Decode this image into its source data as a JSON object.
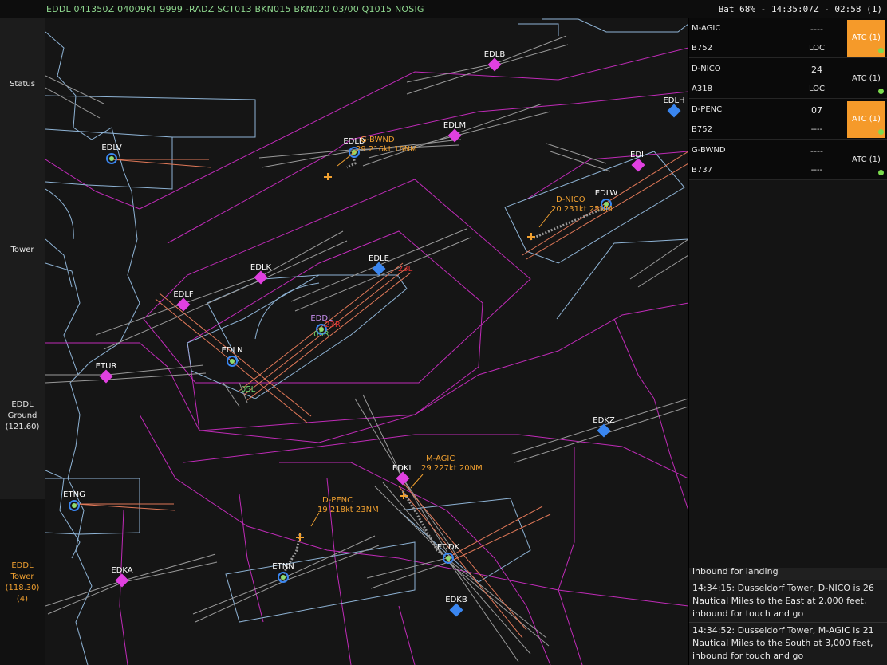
{
  "metar": "EDDL 041350Z 04009KT 9999 -RADZ SCT013 BKN015 BKN020 03/00 Q1015 NOSIG",
  "status_bar": "Bat 68% - 14:35:07Z - 02:58 (1)",
  "sidebar": {
    "status": "Status",
    "tower": "Tower",
    "ground_name": "EDDL",
    "ground_role": "Ground",
    "ground_freq": "(121.60)",
    "active_name": "EDDL",
    "active_role": "Tower",
    "active_freq": "(118.30)",
    "active_count": "(4)"
  },
  "strips": [
    {
      "callsign": "M-AGIC",
      "type": "B752",
      "runway": "----",
      "approach": "LOC",
      "atc": "ATC (1)",
      "highlight": true
    },
    {
      "callsign": "D-NICO",
      "type": "A318",
      "runway": "24",
      "approach": "LOC",
      "atc": "ATC (1)",
      "highlight": false
    },
    {
      "callsign": "D-PENC",
      "type": "B752",
      "runway": "07",
      "approach": "----",
      "atc": "ATC (1)",
      "highlight": true
    },
    {
      "callsign": "G-BWND",
      "type": "B737",
      "runway": "----",
      "approach": "----",
      "atc": "ATC (1)",
      "highlight": false
    }
  ],
  "log": [
    "inbound for landing",
    "14:34:15: Dusseldorf Tower, D-NICO is 26 Nautical Miles to the East at 2,000 feet, inbound for touch and go",
    "14:34:52: Dusseldorf Tower, M-AGIC is 21 Nautical Miles to the South at 3,000 feet, inbound for touch and go"
  ],
  "map": {
    "waypoints_magenta": [
      {
        "name": "EDLB"
      },
      {
        "name": "EDLM"
      },
      {
        "name": "EDII"
      },
      {
        "name": "EDLK"
      },
      {
        "name": "EDLF"
      },
      {
        "name": "ETUR"
      },
      {
        "name": "EDKL"
      },
      {
        "name": "EDKA"
      }
    ],
    "waypoints_blue": [
      {
        "name": "EDLH"
      },
      {
        "name": "EDLE"
      },
      {
        "name": "EDKZ"
      },
      {
        "name": "EDKB"
      }
    ],
    "airports": [
      {
        "name": "EDLV"
      },
      {
        "name": "EDLD"
      },
      {
        "name": "EDLW"
      },
      {
        "name": "EDDL"
      },
      {
        "name": "EDLN"
      },
      {
        "name": "ETNG"
      },
      {
        "name": "ETNN"
      },
      {
        "name": "EDDK"
      }
    ],
    "runway_labels": {
      "r23l": "23L",
      "r05r": "05R",
      "r05l": "05L",
      "r23r": "23R"
    },
    "aircraft": [
      {
        "callsign": "G-BWND",
        "data": "29 216kt 16NM"
      },
      {
        "callsign": "D-NICO",
        "data": "20 231kt 25NM"
      },
      {
        "callsign": "M-AGIC",
        "data": "29 227kt 20NM"
      },
      {
        "callsign": "D-PENC",
        "data": "19 218kt 23NM"
      }
    ],
    "colors": {
      "magenta": "#e040e0",
      "airspace": "#c02bb8",
      "border": "#8fb4d6",
      "approach": "#e07858",
      "aircraft": "#f0a030"
    }
  }
}
